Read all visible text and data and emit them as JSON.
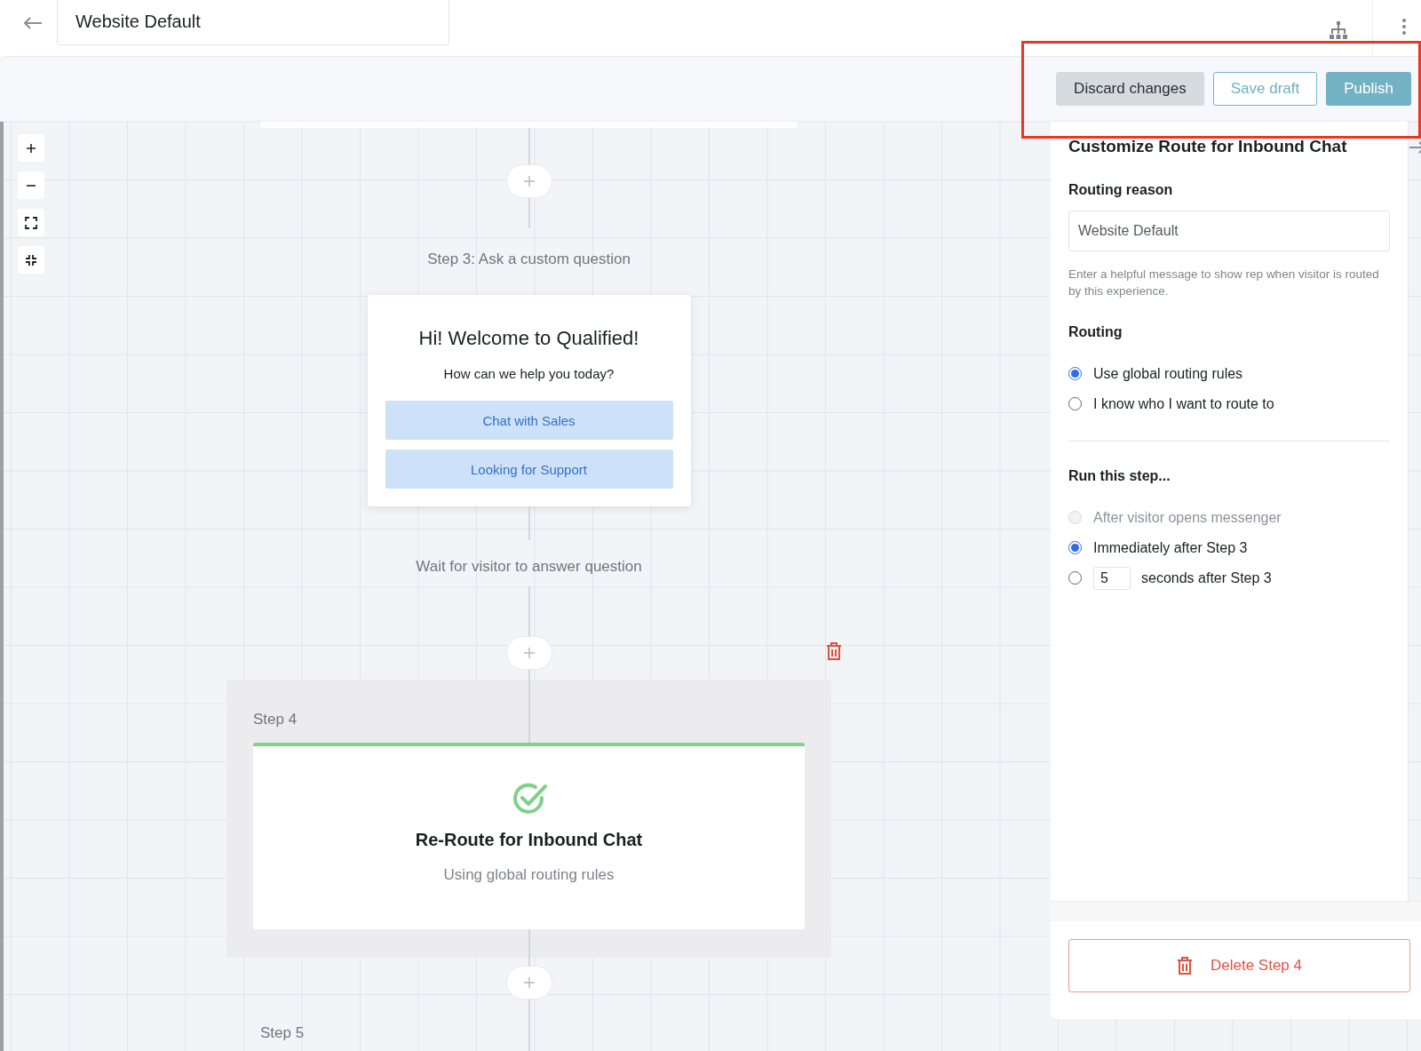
{
  "header": {
    "title": "Website Default"
  },
  "actions": [
    {
      "label": "Discard changes",
      "kind": "secondary"
    },
    {
      "label": "Save draft",
      "kind": "outline"
    },
    {
      "label": "Publish",
      "kind": "primary"
    }
  ],
  "flow": {
    "step3_label": "Step 3: Ask a custom question",
    "question_card": {
      "title": "Hi! Welcome to Qualified!",
      "subtitle": "How can we help you today?",
      "options": [
        "Chat with Sales",
        "Looking for Support"
      ]
    },
    "wait_label": "Wait for visitor to answer question",
    "step4": {
      "label": "Step 4",
      "title": "Re-Route for Inbound Chat",
      "subtitle": "Using global routing rules"
    },
    "step5_label": "Step 5"
  },
  "panel": {
    "title": "Customize Route for Inbound Chat",
    "reason": {
      "label": "Routing reason",
      "value": "Website Default",
      "help": "Enter a helpful message to show rep when visitor is routed by this experience."
    },
    "routing": {
      "label": "Routing",
      "options": [
        {
          "kind": "plain",
          "label": "Use global routing rules",
          "selected": true,
          "disabled": false
        },
        {
          "kind": "plain",
          "label": "I know who I want to route to",
          "selected": false,
          "disabled": false
        }
      ]
    },
    "run_step": {
      "label": "Run this step...",
      "options": [
        {
          "kind": "plain",
          "label": "After visitor opens messenger",
          "selected": false,
          "disabled": true
        },
        {
          "kind": "plain",
          "label": "Immediately after Step 3",
          "selected": true,
          "disabled": false
        },
        {
          "kind": "delay",
          "value": "5",
          "label": "seconds after Step 3",
          "selected": false,
          "disabled": false
        }
      ]
    },
    "delete_button": "Delete Step 4"
  }
}
